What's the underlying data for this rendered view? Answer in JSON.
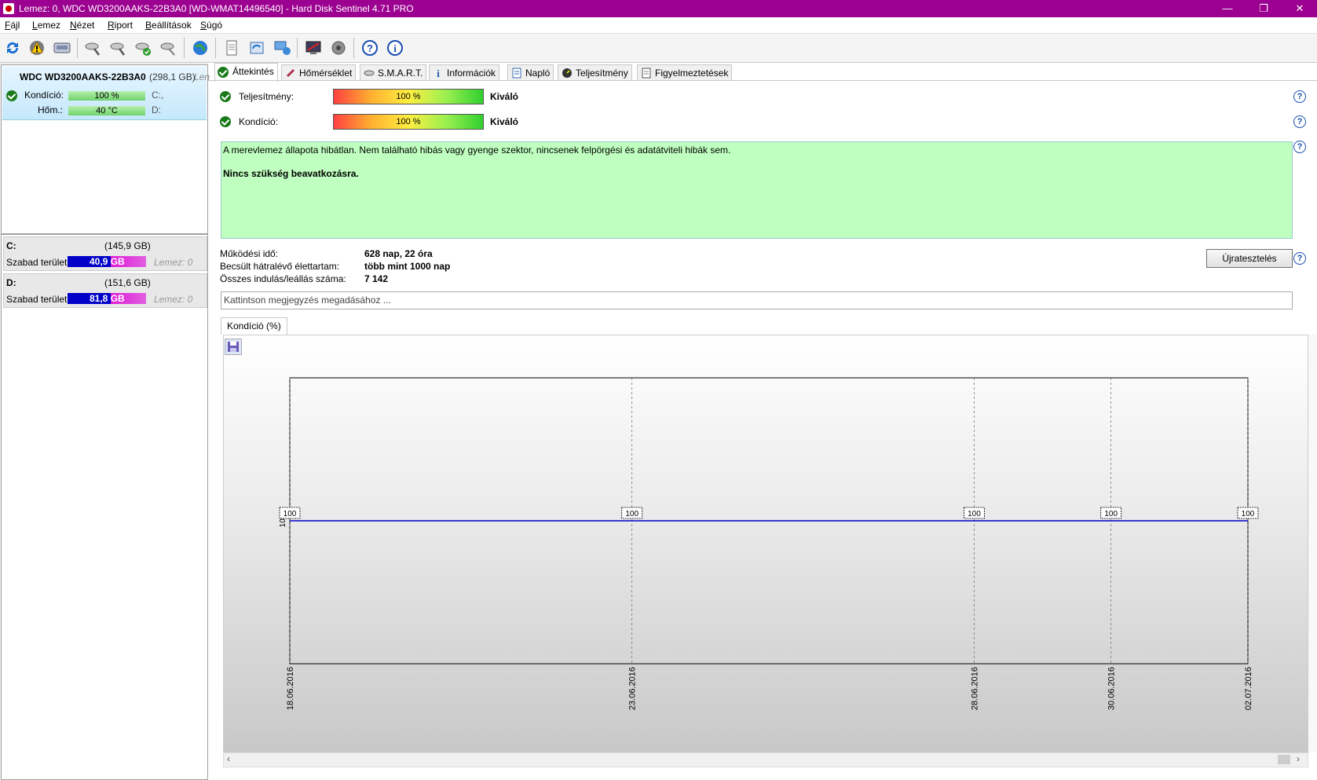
{
  "window": {
    "title": "Lemez: 0, WDC WD3200AAKS-22B3A0 [WD-WMAT14496540]  -  Hard Disk Sentinel 4.71 PRO",
    "minimize": "—",
    "restore": "❐",
    "close": "✕"
  },
  "menu": [
    "Fájl",
    "Lemez",
    "Nézet",
    "Riport",
    "Beállítások",
    "Súgó"
  ],
  "toolbar": {
    "icons": [
      "refresh-icon",
      "alert-icon",
      "disk-icon",
      "disk-test-icon",
      "disk-test2-icon",
      "disk-ok-icon",
      "disk-wrench-icon",
      "web-icon",
      "report-icon",
      "send-icon",
      "network-icon",
      "monitor-icon",
      "sound-icon",
      "help-icon",
      "info-icon"
    ]
  },
  "disk": {
    "name": "WDC WD3200AAKS-22B3A0",
    "size": "(298,1 GB)",
    "extra": "Len",
    "condition_label": "Kondíció:",
    "condition_value": "100 %",
    "temp_label": "Hőm.:",
    "temp_value": "40 °C",
    "drive_c": "C:,",
    "drive_d": "D:"
  },
  "volumes": [
    {
      "letter": "C:",
      "size": "(145,9 GB)",
      "free_label": "Szabad terület",
      "free_value": "40,9 GB",
      "free_fraction": 0.55,
      "disk": "Lemez: 0"
    },
    {
      "letter": "D:",
      "size": "(151,6 GB)",
      "free_label": "Szabad terület",
      "free_value": "81,8 GB",
      "free_fraction": 0.55,
      "disk": "Lemez: 0"
    }
  ],
  "tabs": [
    "Áttekintés",
    "Hőmérséklet",
    "S.M.A.R.T.",
    "Információk",
    "Napló",
    "Teljesítmény",
    "Figyelmeztetések"
  ],
  "overview": {
    "performance_label": "Teljesítmény:",
    "performance_value": "100 %",
    "performance_rating": "Kiváló",
    "condition_label": "Kondíció:",
    "condition_value": "100 %",
    "condition_rating": "Kiváló",
    "status_text": "A merevlemez állapota hibátlan. Nem található hibás vagy gyenge szektor, nincsenek felpörgési és adatátviteli hibák sem.",
    "status_action": "Nincs szükség beavatkozásra.",
    "uptime_label": "Működési idő:",
    "uptime_value": "628 nap, 22 óra",
    "remaining_label": "Becsült hátralévő élettartam:",
    "remaining_value": "több mint 1000 nap",
    "starts_label": "Összes indulás/leállás száma:",
    "starts_value": "7 142",
    "retest_button": "Újratesztelés",
    "note_placeholder": "Kattintson megjegyzés megadásához ...",
    "chart_tab": "Kondíció  (%)"
  },
  "chart_data": {
    "type": "line",
    "x": [
      "18.06.2016",
      "23.06.2016",
      "28.06.2016",
      "30.06.2016",
      "02.07.2016"
    ],
    "values": [
      100,
      100,
      100,
      100,
      100
    ],
    "data_labels": [
      "100",
      "100",
      "100",
      "100",
      "100"
    ],
    "y_tick": "100",
    "color": "#0000cc"
  }
}
